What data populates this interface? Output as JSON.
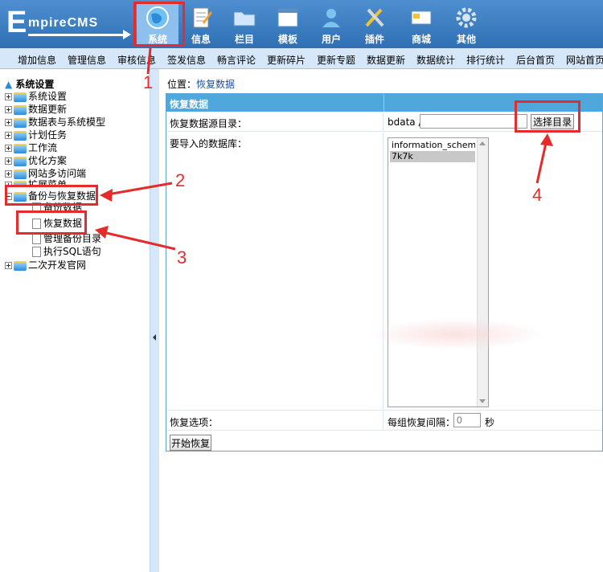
{
  "header": {
    "logo_big": "E",
    "logo_rest": "mpireCMS",
    "nav": [
      {
        "label": "系统",
        "icon": "globe-icon"
      },
      {
        "label": "信息",
        "icon": "notepad-icon"
      },
      {
        "label": "栏目",
        "icon": "folder-icon"
      },
      {
        "label": "模板",
        "icon": "window-icon"
      },
      {
        "label": "用户",
        "icon": "user-icon"
      },
      {
        "label": "插件",
        "icon": "tools-icon"
      },
      {
        "label": "商城",
        "icon": "card-icon"
      },
      {
        "label": "其他",
        "icon": "gear-icon"
      }
    ]
  },
  "submenu": [
    "增加信息",
    "管理信息",
    "审核信息",
    "签发信息",
    "畅言评论",
    "更新碎片",
    "更新专题",
    "数据更新",
    "数据统计",
    "排行统计",
    "后台首页",
    "网站首页"
  ],
  "sidebar": {
    "root": "系统设置",
    "items": [
      "系统设置",
      "数据更新",
      "数据表与系统模型",
      "计划任务",
      "工作流",
      "优化方案",
      "网站多访问端",
      "扩展菜单",
      "备份与恢复数据"
    ],
    "children": [
      "备份数据",
      "恢复数据",
      "管理备份目录",
      "执行SQL语句"
    ],
    "last": "二次开发官网"
  },
  "main": {
    "location_label": "位置：",
    "location_value": "恢复数据",
    "panel_title": "恢复数据",
    "path_label": "恢复数据源目录：",
    "path_prefix": "bdata /",
    "path_value": "",
    "choose_button": "选择目录",
    "db_label": "要导入的数据库：",
    "db_options": [
      "information_schema",
      "7k7k"
    ],
    "options_label": "恢复选项：",
    "interval_label": "每组恢复间隔：",
    "interval_value": "0",
    "sec_label": "秒",
    "start_button": "开始恢复"
  },
  "annotations": [
    "1",
    "2",
    "3",
    "4"
  ],
  "colors": {
    "header_blue": "#2f6fb4",
    "submenu_bg": "#d5e7f8",
    "panel_head": "#4fa8dc",
    "highlight_red": "#e52b2b"
  }
}
